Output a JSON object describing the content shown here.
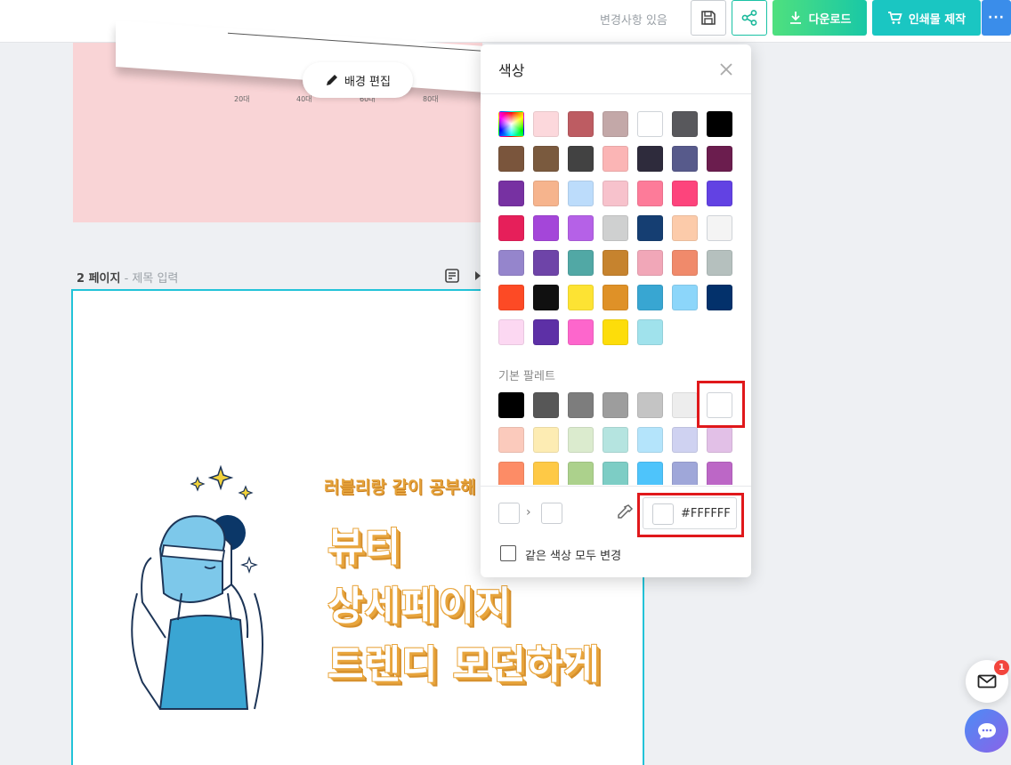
{
  "topbar": {
    "changes_status": "변경사항 있음",
    "download_label": "다운로드",
    "print_label": "인쇄물 제작",
    "more_label": "···"
  },
  "page1": {
    "axis_labels": [
      "20대",
      "40대",
      "60대",
      "80대"
    ],
    "bg_edit_label": "배경 편집"
  },
  "page2": {
    "number_label": "2 페이지",
    "title_placeholder": " - 제목 입력",
    "tagline": "러블리랑 같이 공부해",
    "headline": [
      "뷰티",
      "상세페이지",
      "트렌디 모던하게"
    ]
  },
  "color_panel": {
    "title": "색상",
    "swatches": [
      "rainbow",
      "#fcd8dc",
      "#bd5c62",
      "#c3a8a8",
      "#ffffff",
      "#58585c",
      "#000000",
      "#7a553c",
      "#7a5a3e",
      "#424242",
      "#fbb5b5",
      "#2e2b3c",
      "#575a8b",
      "#6b1d4e",
      "#7731a2",
      "#f6b48d",
      "#bcdcfb",
      "#f7c2cc",
      "#fd7b99",
      "#fd447c",
      "#6242e3",
      "#e61f5a",
      "#a446d9",
      "#b561e7",
      "#cfd0d0",
      "#153e72",
      "#fccbaa",
      "#f4f4f4",
      "#9585cc",
      "#6e44a8",
      "#51a8a5",
      "#c6832e",
      "#f1a7b8",
      "#f08a6b",
      "#b5c0be",
      "#fd4a25",
      "#101010",
      "#fde333",
      "#df9127",
      "#38a6d2",
      "#8cd6fa",
      "#03316b",
      "#fcd8f2",
      "#5d30a6",
      "#fd66cc",
      "#fddd0a",
      "#a0e2ec"
    ],
    "basic_palette_label": "기본 팔레트",
    "basic_swatches": [
      "#000000",
      "#575757",
      "#7d7d7d",
      "#9d9d9d",
      "#c4c4c4",
      "#ededed",
      "#ffffff",
      "#fbcabc",
      "#fdecb3",
      "#dbebce",
      "#b5e4e0",
      "#b4e4fb",
      "#cfd2f1",
      "#e2c0e7",
      "#fd8c66",
      "#fec946",
      "#acd18c",
      "#7dcdc5",
      "#4ec4fb",
      "#9fa7d9",
      "#bc67c6"
    ],
    "hex_value": "#FFFFFF",
    "same_color_label": "같은 색상 모두 변경",
    "highlight_color": "#e0181b"
  },
  "floating": {
    "mail_badge_count": "1"
  }
}
